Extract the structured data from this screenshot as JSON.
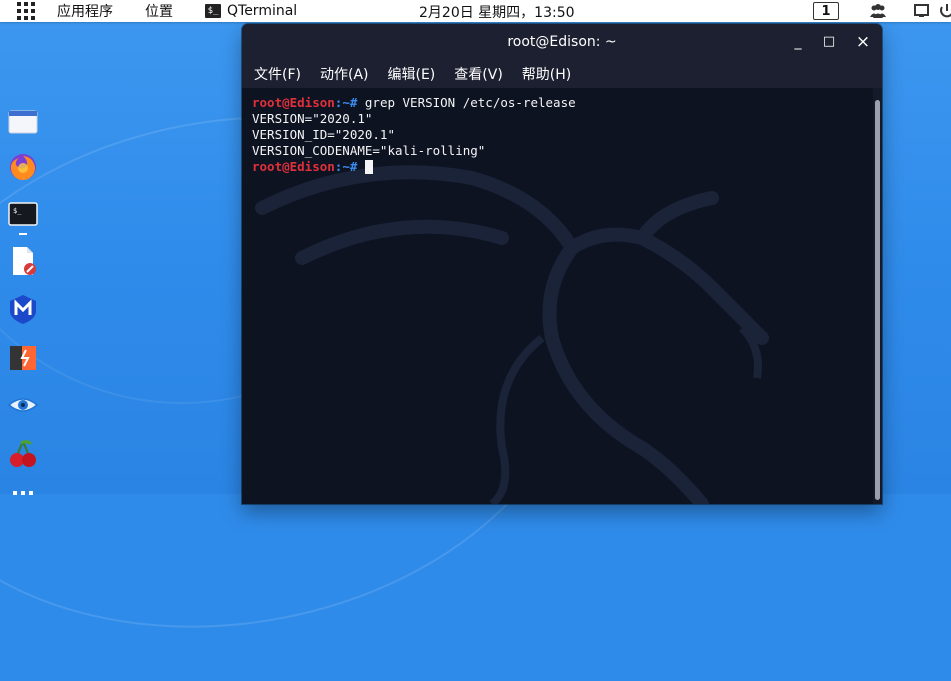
{
  "top_panel": {
    "applications": "应用程序",
    "places": "位置",
    "active_app": "QTerminal",
    "clock": "2月20日 星期四，13:50",
    "workspace": "1",
    "icons": [
      "apps-grid-icon",
      "terminal-app-icon",
      "users-icon",
      "screen-icon",
      "power-icon"
    ]
  },
  "dock": {
    "items": [
      "files-icon",
      "firefox-icon",
      "terminal-icon",
      "text-editor-icon",
      "metasploit-icon",
      "burpsuite-icon",
      "eye-icon",
      "cherrytree-icon",
      "show-apps-icon"
    ],
    "active": "terminal-icon"
  },
  "terminal": {
    "title": "root@Edison: ~",
    "buttons": {
      "minimize": "_",
      "maximize": "□",
      "close": "×"
    },
    "menus": [
      "文件(F)",
      "动作(A)",
      "编辑(E)",
      "查看(V)",
      "帮助(H)"
    ],
    "prompt_user": "root@Edison",
    "prompt_path": ":~#",
    "lines": [
      {
        "type": "command",
        "text": " grep VERSION /etc/os-release"
      },
      {
        "type": "output",
        "text": "VERSION=\"2020.1\""
      },
      {
        "type": "output",
        "text": "VERSION_ID=\"2020.1\""
      },
      {
        "type": "output",
        "text": "VERSION_CODENAME=\"kali-rolling\""
      },
      {
        "type": "command",
        "text": " "
      }
    ]
  },
  "colors": {
    "desktop": "#2f8bea",
    "terminal_bg": "#0e1322",
    "prompt_user": "#e2303a",
    "prompt_path": "#3a8cf0"
  }
}
